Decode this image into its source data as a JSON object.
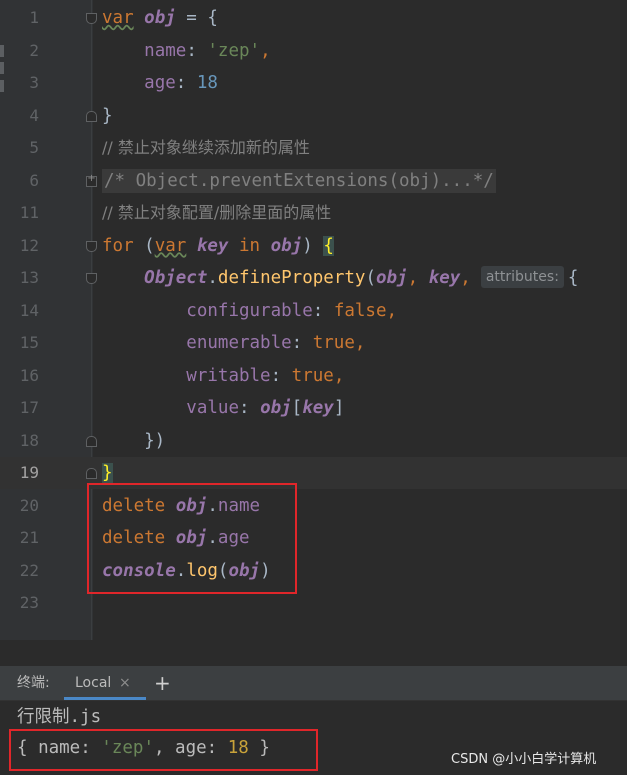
{
  "editor": {
    "lines": [
      {
        "n": "1",
        "active": false,
        "tokens": [
          {
            "t": "var",
            "c": "kw squig"
          },
          {
            "t": " "
          },
          {
            "t": "obj",
            "c": "var"
          },
          {
            "t": " = {"
          }
        ]
      },
      {
        "n": "2",
        "active": false,
        "tokens": [
          {
            "t": "    "
          },
          {
            "t": "name",
            "c": "prop"
          },
          {
            "t": ": "
          },
          {
            "t": "'zep'",
            "c": "str"
          },
          {
            "t": ",",
            "c": "kw"
          }
        ]
      },
      {
        "n": "3",
        "active": false,
        "tokens": [
          {
            "t": "    "
          },
          {
            "t": "age",
            "c": "prop"
          },
          {
            "t": ": "
          },
          {
            "t": "18",
            "c": "num"
          }
        ]
      },
      {
        "n": "4",
        "active": false,
        "tokens": [
          {
            "t": "}"
          }
        ]
      },
      {
        "n": "5",
        "active": false,
        "tokens": [
          {
            "t": "// 禁止对象继续添加新的属性",
            "c": "cmt"
          }
        ]
      },
      {
        "n": "6",
        "active": false,
        "tokens": [
          {
            "t": "/* Object.preventExtensions(obj)...*/",
            "c": "cmt-mono collapsed"
          }
        ]
      },
      {
        "n": "11",
        "active": false,
        "tokens": [
          {
            "t": "// 禁止对象配置/删除里面的属性",
            "c": "cmt"
          }
        ]
      },
      {
        "n": "12",
        "active": false,
        "tokens": [
          {
            "t": "for",
            "c": "kw"
          },
          {
            "t": " ("
          },
          {
            "t": "var",
            "c": "kw squig"
          },
          {
            "t": " "
          },
          {
            "t": "key",
            "c": "var"
          },
          {
            "t": " "
          },
          {
            "t": "in",
            "c": "kw"
          },
          {
            "t": " "
          },
          {
            "t": "obj",
            "c": "var"
          },
          {
            "t": ") "
          },
          {
            "t": "{",
            "c": "brace-hl"
          }
        ]
      },
      {
        "n": "13",
        "active": false,
        "tokens": [
          {
            "t": "    "
          },
          {
            "t": "Object",
            "c": "var"
          },
          {
            "t": "."
          },
          {
            "t": "defineProperty",
            "c": "fn"
          },
          {
            "t": "("
          },
          {
            "t": "obj",
            "c": "var"
          },
          {
            "t": ", ",
            "c": "kw"
          },
          {
            "t": "key",
            "c": "var"
          },
          {
            "t": ",",
            "c": "kw"
          },
          {
            "hint": "attributes:"
          },
          {
            "t": "{"
          }
        ]
      },
      {
        "n": "14",
        "active": false,
        "tokens": [
          {
            "t": "        "
          },
          {
            "t": "configurable",
            "c": "prop"
          },
          {
            "t": ": "
          },
          {
            "t": "false",
            "c": "kw"
          },
          {
            "t": ",",
            "c": "kw"
          }
        ]
      },
      {
        "n": "15",
        "active": false,
        "tokens": [
          {
            "t": "        "
          },
          {
            "t": "enumerable",
            "c": "prop"
          },
          {
            "t": ": "
          },
          {
            "t": "true",
            "c": "kw"
          },
          {
            "t": ",",
            "c": "kw"
          }
        ]
      },
      {
        "n": "16",
        "active": false,
        "tokens": [
          {
            "t": "        "
          },
          {
            "t": "writable",
            "c": "prop"
          },
          {
            "t": ": "
          },
          {
            "t": "true",
            "c": "kw"
          },
          {
            "t": ",",
            "c": "kw"
          }
        ]
      },
      {
        "n": "17",
        "active": false,
        "tokens": [
          {
            "t": "        "
          },
          {
            "t": "value",
            "c": "prop"
          },
          {
            "t": ": "
          },
          {
            "t": "obj",
            "c": "var"
          },
          {
            "t": "["
          },
          {
            "t": "key",
            "c": "var"
          },
          {
            "t": "]"
          }
        ]
      },
      {
        "n": "18",
        "active": false,
        "tokens": [
          {
            "t": "    })"
          }
        ]
      },
      {
        "n": "19",
        "active": true,
        "tokens": [
          {
            "t": "}",
            "c": "brace-hl"
          }
        ]
      },
      {
        "n": "20",
        "active": false,
        "tokens": [
          {
            "t": "delete",
            "c": "kw"
          },
          {
            "t": " "
          },
          {
            "t": "obj",
            "c": "var"
          },
          {
            "t": "."
          },
          {
            "t": "name",
            "c": "prop"
          }
        ]
      },
      {
        "n": "21",
        "active": false,
        "tokens": [
          {
            "t": "delete",
            "c": "kw"
          },
          {
            "t": " "
          },
          {
            "t": "obj",
            "c": "var"
          },
          {
            "t": "."
          },
          {
            "t": "age",
            "c": "prop"
          }
        ]
      },
      {
        "n": "22",
        "active": false,
        "tokens": [
          {
            "t": "console",
            "c": "var"
          },
          {
            "t": "."
          },
          {
            "t": "log",
            "c": "fn"
          },
          {
            "t": "("
          },
          {
            "t": "obj",
            "c": "var"
          },
          {
            "t": ")"
          }
        ]
      },
      {
        "n": "23",
        "active": false,
        "tokens": []
      }
    ]
  },
  "terminal": {
    "title": "终端:",
    "tab_label": "Local",
    "tab_close": "×",
    "add_label": "+",
    "command": "行限制.js",
    "output": [
      {
        "t": "{ name: "
      },
      {
        "t": "'zep'",
        "c": "str"
      },
      {
        "t": ", age: "
      },
      {
        "t": "18",
        "c": "numy"
      },
      {
        "t": " }"
      }
    ]
  },
  "watermark": "CSDN @小小白学计算机",
  "colors": {
    "highlight_box": "#e0262a",
    "keyword": "#cc7832",
    "variable": "#9876aa",
    "string": "#6a8759",
    "number": "#6897bb"
  }
}
